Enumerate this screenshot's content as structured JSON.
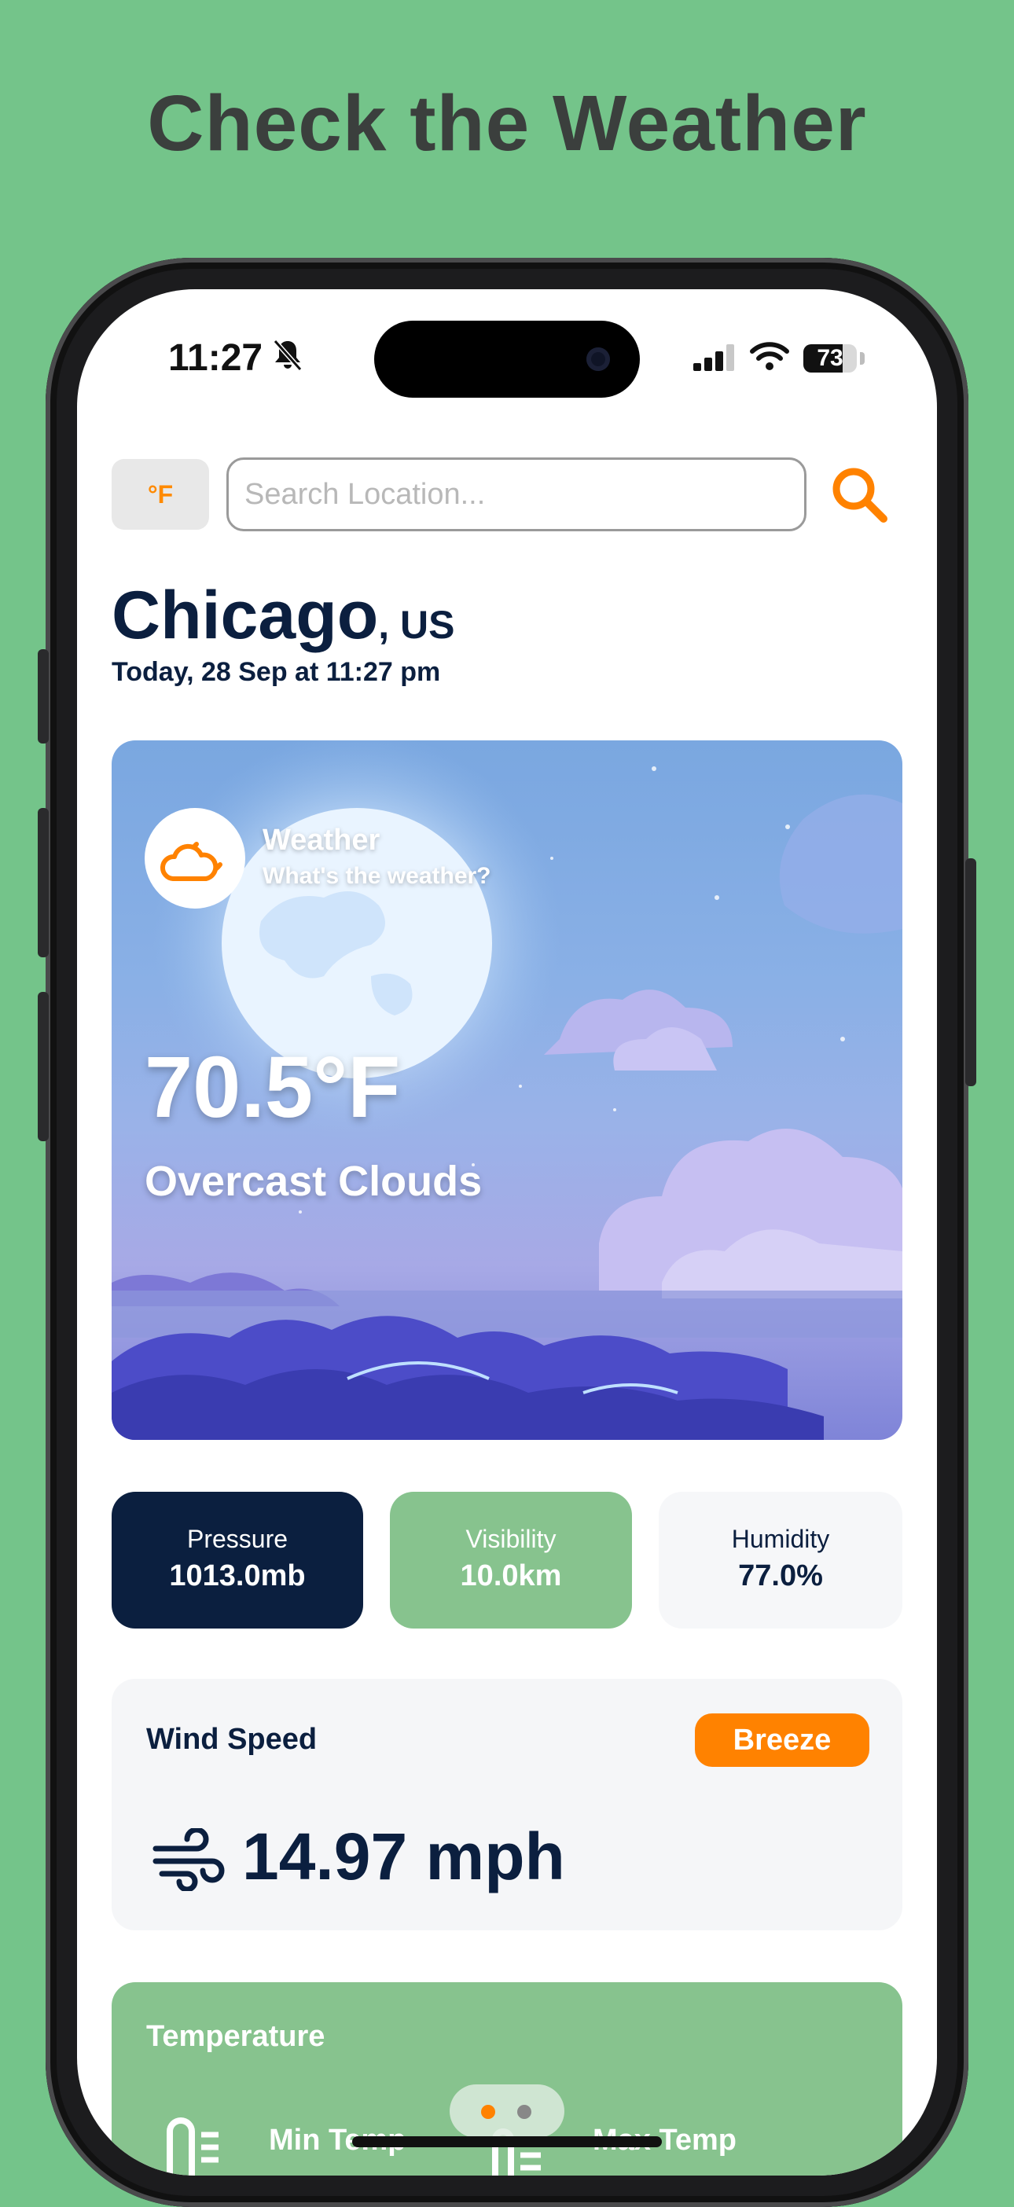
{
  "headline": "Check the Weather",
  "status_bar": {
    "time": "11:27",
    "battery": "73",
    "battery_level": 0.73
  },
  "search": {
    "unit_label": "°F",
    "placeholder": "Search Location..."
  },
  "location": {
    "city": "Chicago",
    "country": ", US",
    "date": "Today, 28 Sep at 11:27 pm"
  },
  "hero": {
    "badge_title": "Weather",
    "badge_subtitle": "What's the weather?",
    "temperature": "70.5°F",
    "condition": "Overcast Clouds"
  },
  "stats": {
    "pressure_label": "Pressure",
    "pressure_value": "1013.0mb",
    "visibility_label": "Visibility",
    "visibility_value": "10.0km",
    "humidity_label": "Humidity",
    "humidity_value": "77.0%"
  },
  "wind": {
    "title": "Wind Speed",
    "badge": "Breeze",
    "value": "14.97 mph"
  },
  "temperature_card": {
    "title": "Temperature",
    "min_label": "Min Temp",
    "max_label": "Max Temp"
  },
  "colors": {
    "accent": "#ff8200",
    "navy": "#0b1f3f",
    "green": "#87c38e",
    "background": "#74c48a"
  },
  "icons": {
    "search": "search-icon",
    "weather": "cloud-moon-icon",
    "wind": "wind-icon",
    "mute": "bell-slash-icon"
  }
}
